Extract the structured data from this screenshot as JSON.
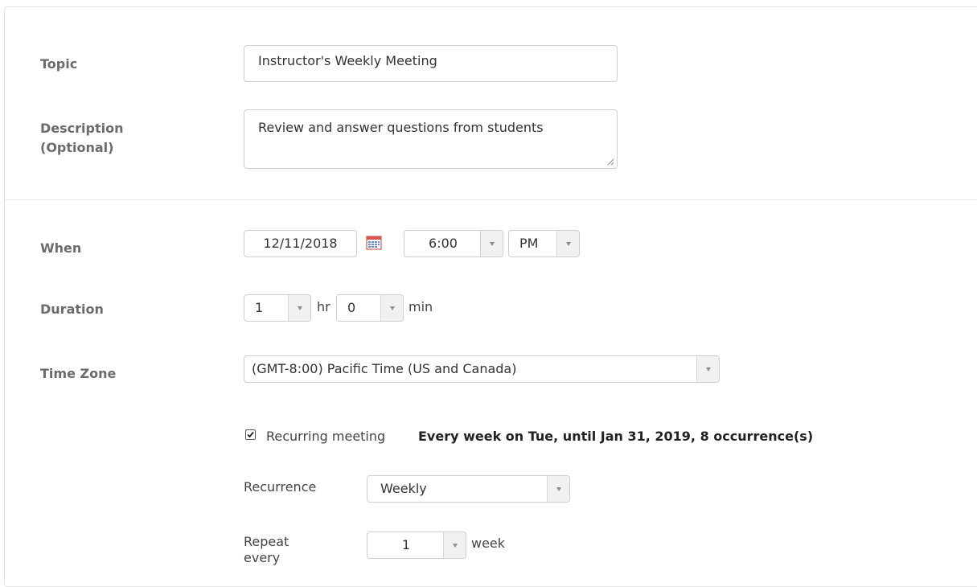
{
  "topic": {
    "label": "Topic",
    "value": "Instructor's Weekly Meeting"
  },
  "description": {
    "label_line1": "Description",
    "label_line2": "(Optional)",
    "value": "Review and answer questions from students"
  },
  "when": {
    "label": "When",
    "date": "12/11/2018",
    "time": "6:00",
    "ampm": "PM"
  },
  "duration": {
    "label": "Duration",
    "hours": "1",
    "hr_unit": "hr",
    "minutes": "0",
    "min_unit": "min"
  },
  "timezone": {
    "label": "Time Zone",
    "value": "(GMT-8:00) Pacific Time (US and Canada)"
  },
  "recurring": {
    "checked": true,
    "label": "Recurring meeting",
    "summary": "Every week on Tue, until Jan 31, 2019, 8 occurrence(s)"
  },
  "recurrence": {
    "label": "Recurrence",
    "value": "Weekly"
  },
  "repeat": {
    "label_line1": "Repeat",
    "label_line2": "every",
    "value": "1",
    "unit": "week"
  },
  "icons": {
    "calendar": "calendar-icon",
    "dropdown": "chevron-down-icon",
    "checkbox": "checkmark-icon"
  },
  "colors": {
    "border": "#cfcfcf",
    "label": "#6b6b6b",
    "text": "#333333"
  }
}
